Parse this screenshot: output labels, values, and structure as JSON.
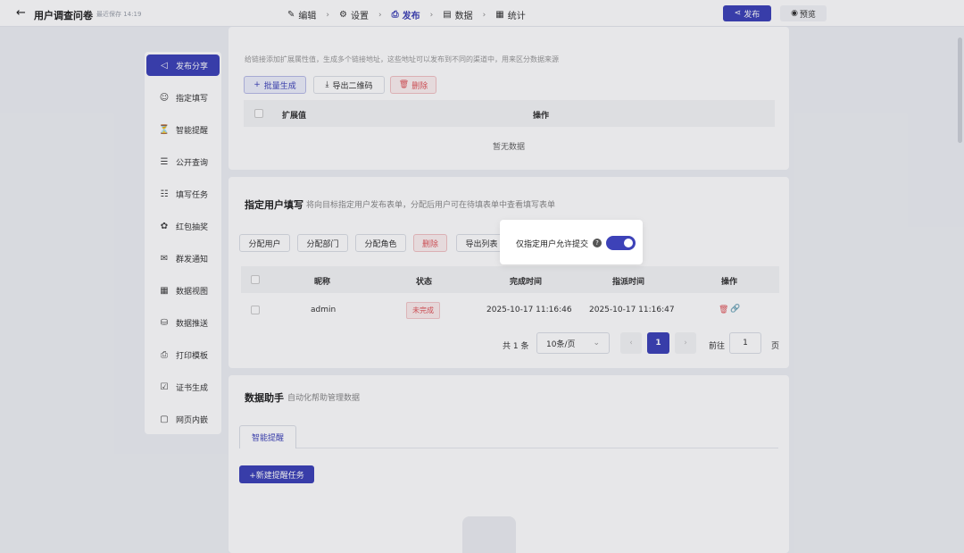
{
  "header": {
    "title": "用户调查问卷",
    "save_status": "最近保存 14:19",
    "steps": [
      {
        "icon": "✎",
        "label": "编辑"
      },
      {
        "icon": "⚙",
        "label": "设置"
      },
      {
        "icon": "⎙",
        "label": "发布"
      },
      {
        "icon": "▤",
        "label": "数据"
      },
      {
        "icon": "▦",
        "label": "统计"
      }
    ],
    "publish_label": "发布",
    "preview_label": "预览"
  },
  "sidebar": {
    "items": [
      {
        "icon": "◁",
        "label": "发布分享"
      },
      {
        "icon": "☺",
        "label": "指定填写"
      },
      {
        "icon": "⏳",
        "label": "智能提醒"
      },
      {
        "icon": "☰",
        "label": "公开查询"
      },
      {
        "icon": "☷",
        "label": "填写任务"
      },
      {
        "icon": "✿",
        "label": "红包抽奖"
      },
      {
        "icon": "✉",
        "label": "群发通知"
      },
      {
        "icon": "▦",
        "label": "数据视图"
      },
      {
        "icon": "⛁",
        "label": "数据推送"
      },
      {
        "icon": "⎙",
        "label": "打印模板"
      },
      {
        "icon": "☑",
        "label": "证书生成"
      },
      {
        "icon": "▢",
        "label": "网页内嵌"
      }
    ]
  },
  "links_section": {
    "hint": "给链接添加扩展属性值，生成多个链接地址，这些地址可以发布到不同的渠道中，用来区分数据来源",
    "batch_label": "批量生成",
    "export_qr_label": "导出二维码",
    "delete_label": "删除",
    "col_ext": "扩展值",
    "col_op": "操作",
    "empty": "暂无数据"
  },
  "assign_section": {
    "title": "指定用户填写",
    "hint": "将向目标指定用户发布表单，分配后用户可在待填表单中查看填写表单",
    "buttons": [
      "分配用户",
      "分配部门",
      "分配角色",
      "删除",
      "导出列表"
    ],
    "columns": [
      "昵称",
      "状态",
      "完成时间",
      "指派时间",
      "操作"
    ],
    "row": {
      "name": "admin",
      "status": "未完成",
      "done": "2025-10-17 11:16:46",
      "assigned": "2025-10-17 11:16:47"
    },
    "pagination": {
      "total": "共 1 条",
      "page_size": "10条/页",
      "current": "1",
      "goto": "前往",
      "goto_value": "1",
      "page_unit": "页"
    }
  },
  "popup": {
    "label": "仅指定用户允许提交",
    "toggle_on": true
  },
  "helper_section": {
    "title": "数据助手",
    "hint": "自动化帮助管理数据",
    "tab": "智能提醒",
    "new_task": "+新建提醒任务"
  }
}
